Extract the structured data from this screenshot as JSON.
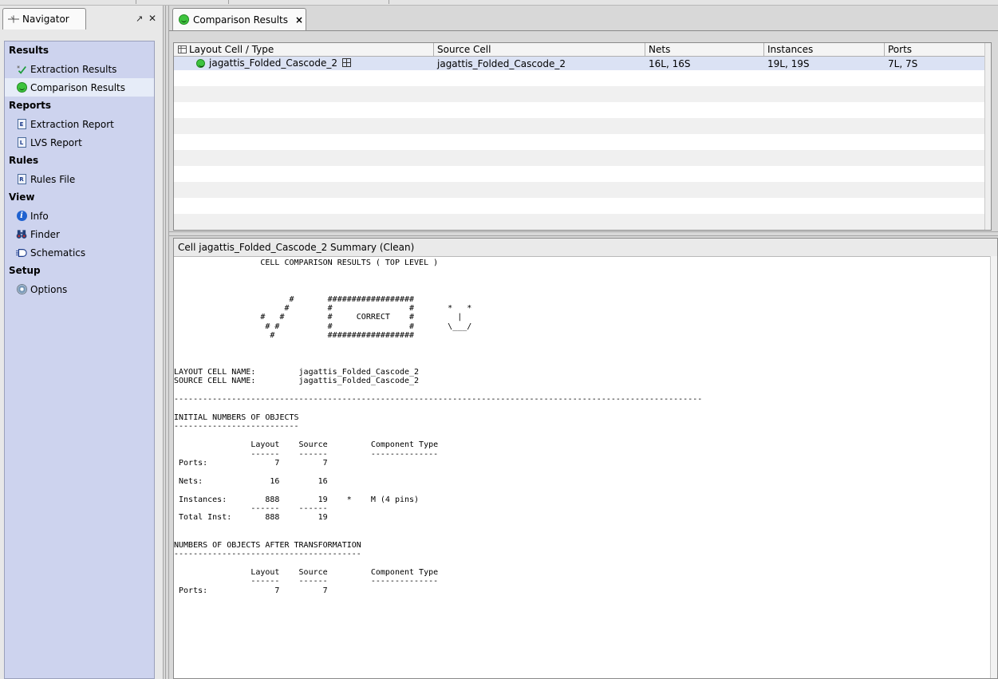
{
  "navigator": {
    "tab_label": "Navigator",
    "float_glyph": "↗",
    "close_glyph": "✕",
    "sections": [
      {
        "label": "Results",
        "items": [
          {
            "label": "Extraction Results",
            "icon": "extraction-check-icon"
          },
          {
            "label": "Comparison Results",
            "icon": "smiley-icon",
            "selected": true
          }
        ]
      },
      {
        "label": "Reports",
        "items": [
          {
            "label": "Extraction Report",
            "icon": "report-e-icon"
          },
          {
            "label": "LVS Report",
            "icon": "report-l-icon"
          }
        ]
      },
      {
        "label": "Rules",
        "items": [
          {
            "label": "Rules File",
            "icon": "rules-file-icon"
          }
        ]
      },
      {
        "label": "View",
        "items": [
          {
            "label": "Info",
            "icon": "info-icon"
          },
          {
            "label": "Finder",
            "icon": "binoculars-icon"
          },
          {
            "label": "Schematics",
            "icon": "schematic-icon"
          }
        ]
      },
      {
        "label": "Setup",
        "items": [
          {
            "label": "Options",
            "icon": "gear-icon"
          }
        ]
      }
    ]
  },
  "doc_tab": {
    "label": "Comparison Results",
    "close": "×"
  },
  "grid": {
    "columns": [
      "Layout Cell / Type",
      "Source Cell",
      "Nets",
      "Instances",
      "Ports"
    ],
    "rows": [
      {
        "layout_cell": "jagattis_Folded_Cascode_2",
        "source_cell": "jagattis_Folded_Cascode_2",
        "nets": "16L, 16S",
        "instances": "19L, 19S",
        "ports": "7L, 7S"
      }
    ]
  },
  "summary": {
    "title": "Cell jagattis_Folded_Cascode_2 Summary (Clean)",
    "report_text": "                  CELL COMPARISON RESULTS ( TOP LEVEL )\n\n\n\n                        #       ##################\n                       #        #                #       *   *\n                  #   #         #     CORRECT    #         |\n                   # #          #                #       \\___/\n                    #           ##################\n\n\n\nLAYOUT CELL NAME:         jagattis_Folded_Cascode_2\nSOURCE CELL NAME:         jagattis_Folded_Cascode_2\n\n--------------------------------------------------------------------------------------------------------------\n\nINITIAL NUMBERS OF OBJECTS\n--------------------------\n\n                Layout    Source         Component Type\n                ------    ------         --------------\n Ports:              7         7\n\n Nets:              16        16\n\n Instances:        888        19    *    M (4 pins)\n                ------    ------\n Total Inst:       888        19\n\n\nNUMBERS OF OBJECTS AFTER TRANSFORMATION\n---------------------------------------\n\n                Layout    Source         Component Type\n                ------    ------         --------------\n Ports:              7         7"
  }
}
